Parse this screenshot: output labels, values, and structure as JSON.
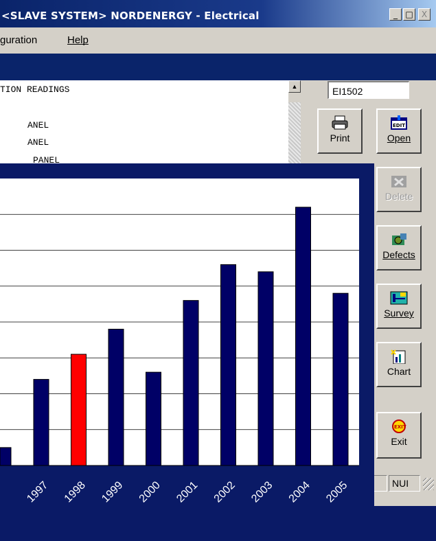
{
  "window": {
    "title": "<SLAVE SYSTEM> NORDENERGY - Electrical",
    "controls": [
      "_",
      "□",
      "X"
    ]
  },
  "menu": {
    "items": [
      "guration",
      "Help"
    ]
  },
  "report": {
    "lines": [
      "TION READINGS",
      "ANEL",
      "ANEL",
      "PANEL"
    ]
  },
  "toolbar": {
    "code_value": "EI1502",
    "buttons": [
      {
        "label": "Print",
        "icon": "printer-icon",
        "enabled": true
      },
      {
        "label": "Open",
        "icon": "edit-icon",
        "enabled": true
      },
      {
        "label": "Delete",
        "icon": "delete-icon",
        "enabled": false
      },
      {
        "label": "Defects",
        "icon": "defects-icon",
        "enabled": true
      },
      {
        "label": "Survey",
        "icon": "survey-icon",
        "enabled": true
      },
      {
        "label": "Chart",
        "icon": "chart-icon",
        "enabled": true
      },
      {
        "label": "Exit",
        "icon": "exit-icon",
        "enabled": true
      }
    ]
  },
  "status": {
    "mode": "NUI"
  },
  "colors": {
    "bar": "#000066",
    "highlight": "#ff0000",
    "background": "#0a1a66"
  },
  "chart_data": {
    "type": "bar",
    "categories": [
      "1997",
      "1998",
      "1999",
      "2000",
      "2001",
      "2002",
      "2003",
      "2004",
      "2005"
    ],
    "values": [
      2.4,
      3.1,
      3.8,
      2.6,
      4.6,
      5.6,
      5.4,
      7.2,
      4.8
    ],
    "partial_left_value": 0.5,
    "highlight_category": "1998",
    "ylim": [
      0,
      8
    ],
    "grid": true
  }
}
